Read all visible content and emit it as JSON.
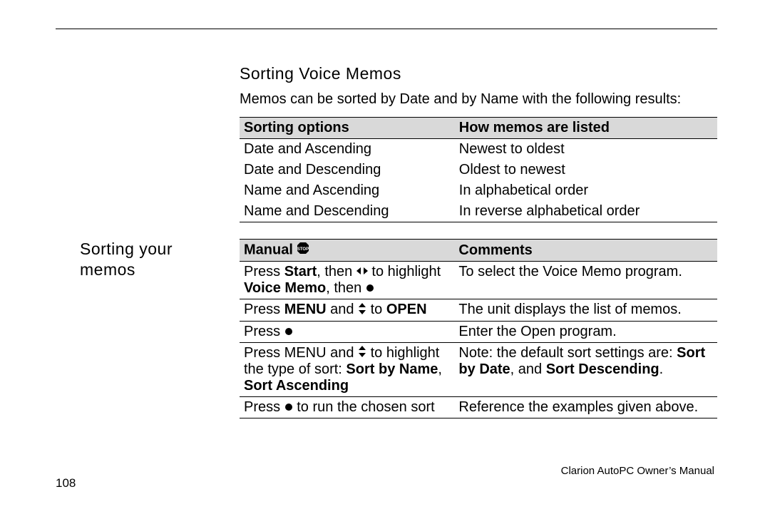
{
  "section_title": "Sorting Voice Memos",
  "intro": "Memos can be sorted by Date and by Name with the following results:",
  "margin_heading": "Sorting your memos",
  "table1": {
    "headers": [
      "Sorting options",
      "How memos are listed"
    ],
    "rows": [
      [
        "Date and Ascending",
        "Newest to oldest"
      ],
      [
        "Date and Descending",
        "Oldest to newest"
      ],
      [
        "Name and Ascending",
        "In alphabetical order"
      ],
      [
        "Name and Descending",
        "In reverse alphabetical order"
      ]
    ]
  },
  "table2": {
    "headers": [
      "Manual ",
      "Comments"
    ],
    "rows": [
      {
        "c1_pre": "Press ",
        "c1_b1": "Start",
        "c1_mid": ", then ",
        "c1_icon": "leftright",
        "c1_post": " to highlight ",
        "c1_b2": "Voice Memo",
        "c1_post2": ", then ",
        "c1_icon2": "dot",
        "c2": "To select the Voice Memo program."
      },
      {
        "c1_pre": "Press ",
        "c1_b1": "MENU",
        "c1_mid": " and ",
        "c1_icon": "updown",
        "c1_post": " to ",
        "c1_b2": "OPEN",
        "c2": "The unit displays the list of memos."
      },
      {
        "c1_pre": "Press ",
        "c1_icon": "dot",
        "c2": "Enter the Open program."
      },
      {
        "c1_pre": "Press MENU and ",
        "c1_icon": "updown",
        "c1_post": " to highlight the type of sort:  ",
        "c1_b1": "Sort by Name",
        "c1_mid": ", ",
        "c1_b2": "Sort Ascending",
        "c2_pre": "Note:  the default sort settings are:  ",
        "c2_b1": "Sort by Date",
        "c2_mid": ", and ",
        "c2_b2": "Sort Descending",
        "c2_post": "."
      },
      {
        "c1_pre": "Press ",
        "c1_icon": "dot",
        "c1_post": " to run the chosen sort",
        "c2": "Reference the examples given above."
      }
    ]
  },
  "footer_right": "Clarion AutoPC Owner’s Manual",
  "footer_left": "108",
  "chart_data": {
    "type": "table",
    "tables": [
      {
        "headers": [
          "Sorting options",
          "How memos are listed"
        ],
        "rows": [
          [
            "Date and Ascending",
            "Newest to oldest"
          ],
          [
            "Date and Descending",
            "Oldest to newest"
          ],
          [
            "Name and Ascending",
            "In alphabetical order"
          ],
          [
            "Name and Descending",
            "In reverse alphabetical order"
          ]
        ]
      },
      {
        "headers": [
          "Manual (STOP)",
          "Comments"
        ],
        "rows": [
          [
            "Press Start, then ◀▶ to highlight Voice Memo, then ●",
            "To select the Voice Memo program."
          ],
          [
            "Press MENU and ▲▼ to OPEN",
            "The unit displays the list of memos."
          ],
          [
            "Press ●",
            "Enter the Open program."
          ],
          [
            "Press MENU and ▲▼ to highlight the type of sort: Sort by Name, Sort Ascending",
            "Note: the default sort settings are: Sort by Date, and Sort Descending."
          ],
          [
            "Press ● to run the chosen sort",
            "Reference the examples given above."
          ]
        ]
      }
    ]
  }
}
